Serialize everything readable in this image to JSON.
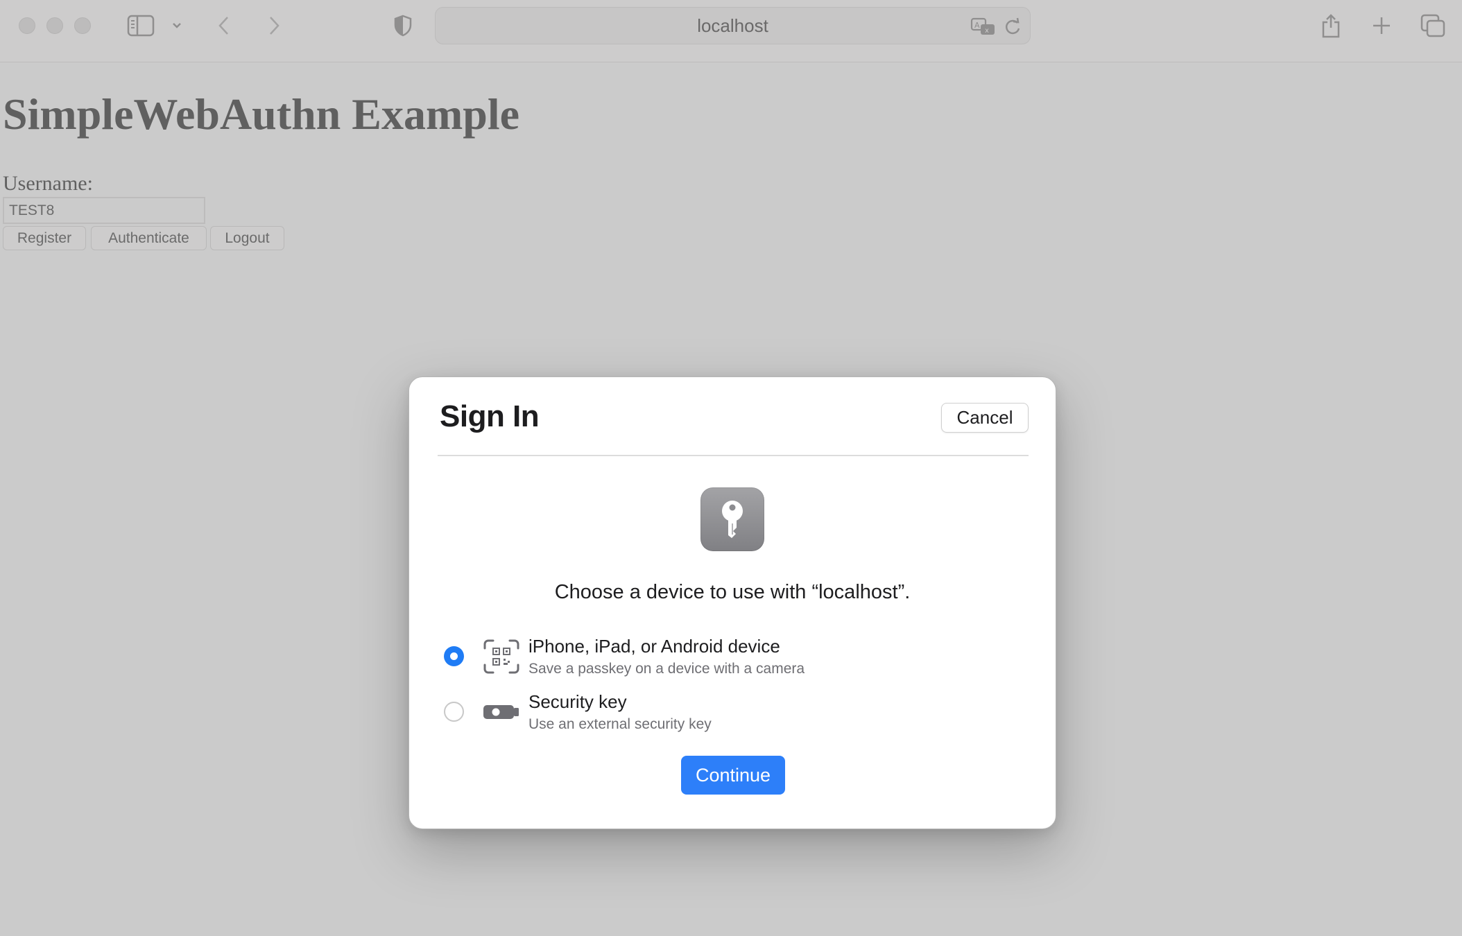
{
  "browser": {
    "address": "localhost",
    "icons": {
      "sidebar": "sidebar-icon",
      "chevron": "chevron-down-icon",
      "back": "back-arrow-icon",
      "forward": "forward-arrow-icon",
      "privacy": "shield-icon",
      "translate": "translate-icon",
      "reload": "reload-icon",
      "share": "share-icon",
      "new_tab": "plus-icon",
      "tabs": "tab-overview-icon"
    }
  },
  "page": {
    "title": "SimpleWebAuthn Example",
    "username_label": "Username:",
    "username_value": "TEST8",
    "buttons": {
      "register": "Register",
      "authenticate": "Authenticate",
      "logout": "Logout"
    }
  },
  "dialog": {
    "title": "Sign In",
    "cancel": "Cancel",
    "prompt": "Choose a device to use with “localhost”.",
    "options": [
      {
        "title": "iPhone, iPad, or Android device",
        "subtitle": "Save a passkey on a device with a camera",
        "icon": "qr-code-scan-icon",
        "selected": true
      },
      {
        "title": "Security key",
        "subtitle": "Use an external security key",
        "icon": "usb-security-key-icon",
        "selected": false
      }
    ],
    "continue": "Continue",
    "colors": {
      "accent": "#2d7ff9"
    }
  }
}
